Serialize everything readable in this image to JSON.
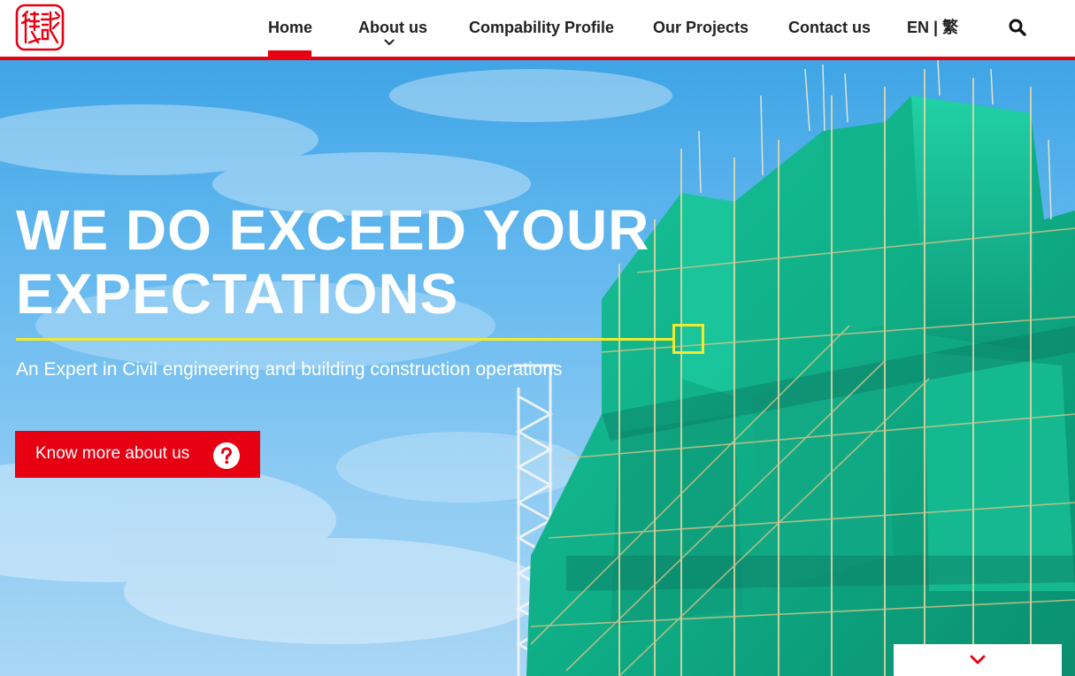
{
  "brand": {
    "logo_name": "company-seal-logo",
    "primary_color": "#e60012",
    "accent_color": "#f2ea2c"
  },
  "nav": {
    "items": [
      {
        "label": "Home",
        "active": true
      },
      {
        "label": "About us",
        "has_dropdown": true
      },
      {
        "label": "Compability Profile"
      },
      {
        "label": "Our Projects"
      },
      {
        "label": "Contact us"
      }
    ],
    "language": "EN | 繁",
    "search_icon": "search-icon"
  },
  "hero": {
    "title_line1": "WE DO EXCEED YOUR",
    "title_line2": "EXPECTATIONS",
    "subtitle": "An Expert in Civil engineering and building construction operations",
    "cta_label": "Know more about us",
    "cta_icon": "question-circle-icon",
    "scroll_icon": "chevron-down-icon"
  }
}
